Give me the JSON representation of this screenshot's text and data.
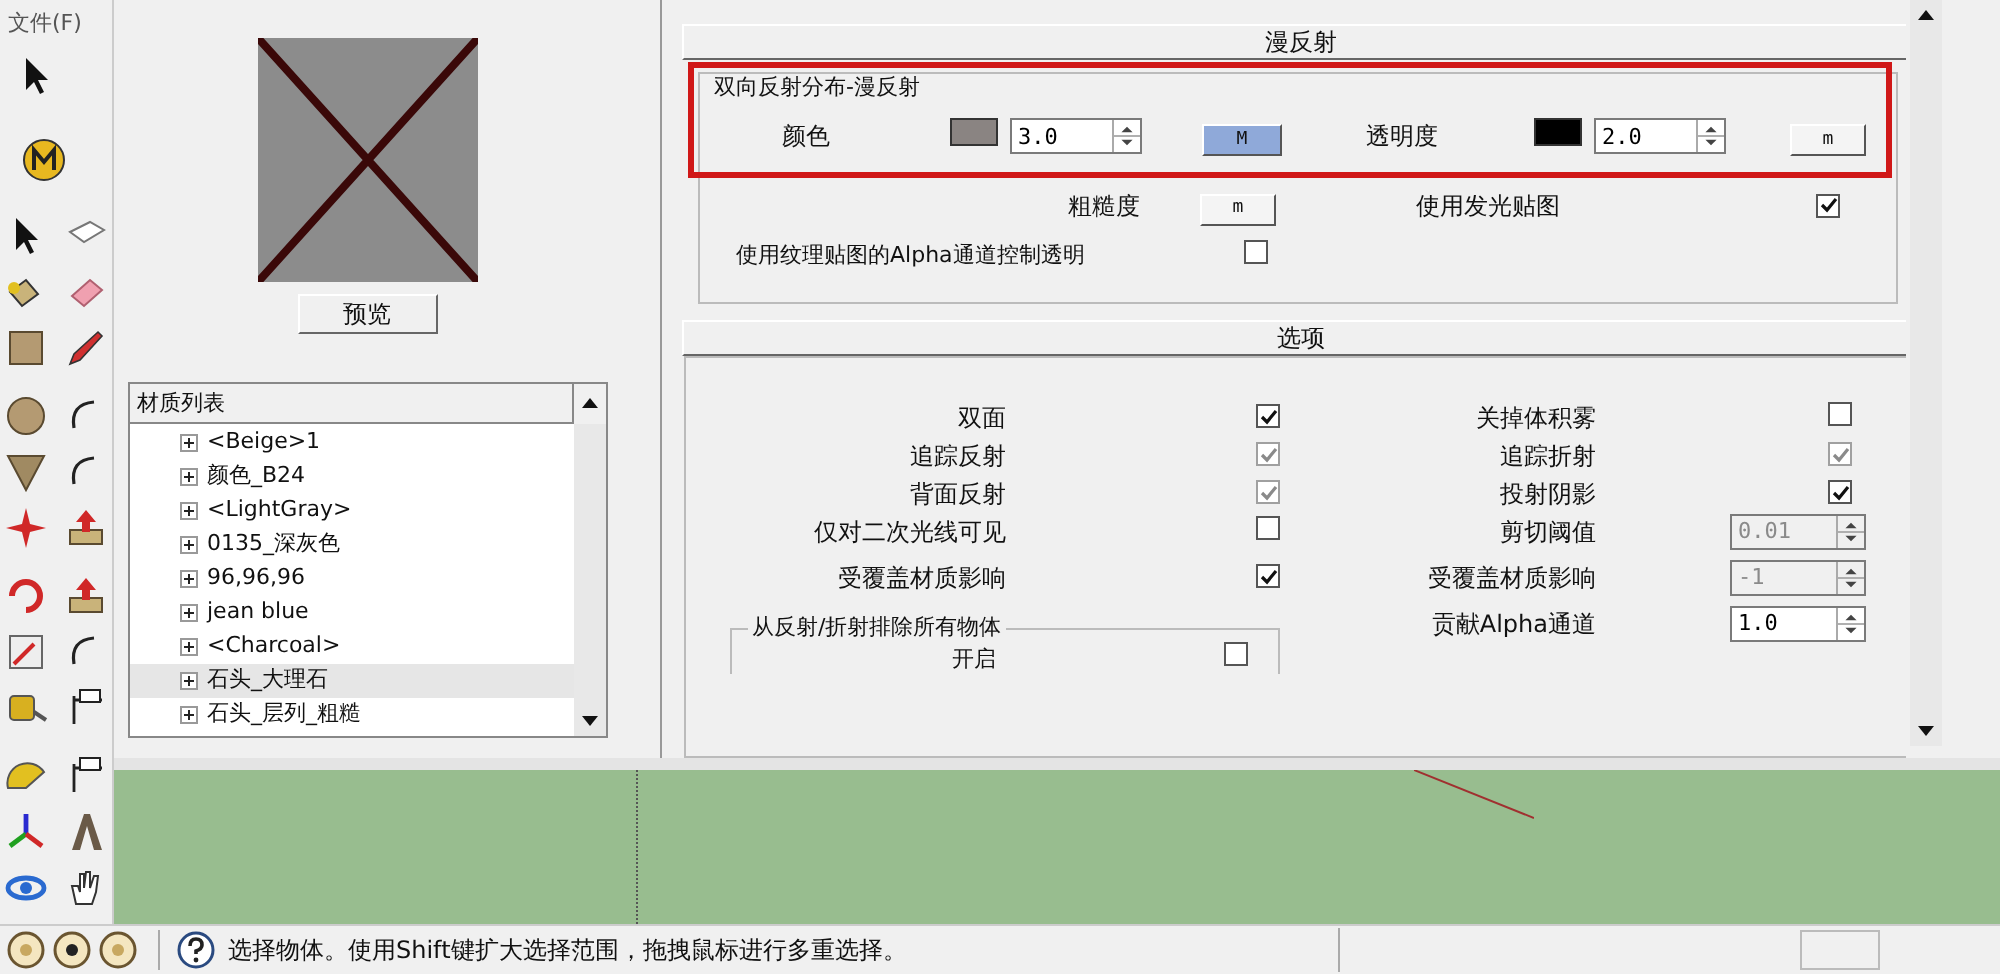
{
  "menu": {
    "label": "文件(F)"
  },
  "preview": {
    "button": "预览"
  },
  "material_list": {
    "title": "材质列表",
    "items": [
      {
        "label": "<Beige>1",
        "selected": false
      },
      {
        "label": "颜色_B24",
        "selected": false
      },
      {
        "label": "<LightGray>",
        "selected": false
      },
      {
        "label": "0135_深灰色",
        "selected": false
      },
      {
        "label": "96,96,96",
        "selected": false
      },
      {
        "label": "jean blue",
        "selected": false
      },
      {
        "label": "<Charcoal>",
        "selected": false
      },
      {
        "label": "石头_大理石",
        "selected": true
      },
      {
        "label": "石头_层列_粗糙",
        "selected": false
      }
    ]
  },
  "diffuse": {
    "title": "漫反射",
    "brdf_group": {
      "title": "双向反射分布-漫反射",
      "highlighted": true,
      "color_label": "颜色",
      "color_swatch": {
        "color": "#8a8482"
      },
      "color_value": "3.0",
      "color_map_button": {
        "label": "M",
        "active": true
      },
      "transparency_label": "透明度",
      "transparency_swatch": {
        "color": "#000000"
      },
      "transparency_value": "2.0",
      "transparency_map_button": {
        "label": "m",
        "active": false
      }
    },
    "roughness_label": "粗糙度",
    "roughness_map_button": {
      "label": "m",
      "active": false
    },
    "emission": {
      "label": "使用发光贴图",
      "checked": true
    },
    "alpha_transparency": {
      "label": "使用纹理贴图的Alpha通道控制透明",
      "checked": false
    }
  },
  "options": {
    "title": "选项",
    "left": [
      {
        "kind": "checkbox",
        "label": "双面",
        "checked": true,
        "disabled": false
      },
      {
        "kind": "checkbox",
        "label": "追踪反射",
        "checked": true,
        "disabled": true
      },
      {
        "kind": "checkbox",
        "label": "背面反射",
        "checked": true,
        "disabled": true
      },
      {
        "kind": "checkbox",
        "label": "仅对二次光线可见",
        "checked": false,
        "disabled": false
      },
      {
        "kind": "checkbox",
        "label": "受覆盖材质影响",
        "checked": true,
        "disabled": false
      }
    ],
    "right": [
      {
        "kind": "checkbox",
        "label": "关掉体积雾",
        "checked": false,
        "disabled": false
      },
      {
        "kind": "checkbox",
        "label": "追踪折射",
        "checked": true,
        "disabled": true
      },
      {
        "kind": "checkbox",
        "label": "投射阴影",
        "checked": true,
        "disabled": false
      },
      {
        "kind": "spinner",
        "label": "剪切阈值",
        "value": "0.01",
        "disabled": true
      },
      {
        "kind": "spinner",
        "label": "受覆盖材质影响",
        "value": "-1",
        "disabled": true
      },
      {
        "kind": "spinner",
        "label": "贡献Alpha通道",
        "value": "1.0",
        "disabled": false
      }
    ],
    "exclude_group": {
      "title": "从反射/折射排除所有物体",
      "items": [
        {
          "label": "开启",
          "checked": false
        }
      ]
    }
  },
  "status_bar": {
    "text": "选择物体。使用Shift键扩大选择范围，拖拽鼠标进行多重选择。"
  }
}
